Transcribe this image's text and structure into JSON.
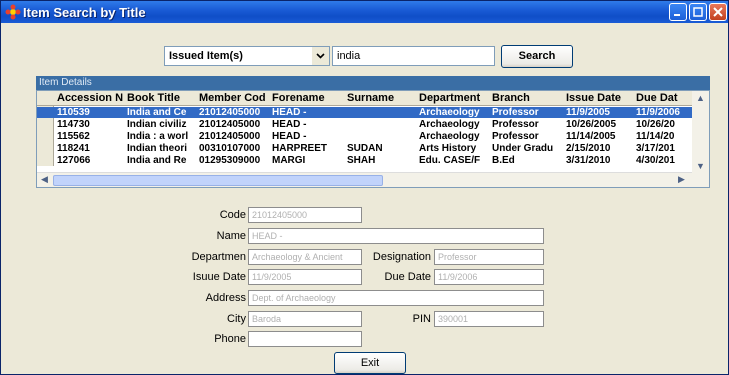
{
  "window": {
    "title": "Item Search by Title"
  },
  "search": {
    "filter_value": "Issued Item(s)",
    "query": "india",
    "button_label": "Search"
  },
  "grid": {
    "group_title": "Item Details",
    "columns": [
      "Accession N",
      "Book Title",
      "Member Cod",
      "Forename",
      "Surname",
      "Department",
      "Branch",
      "Issue Date",
      "Due Dat"
    ],
    "rows": [
      [
        "110539",
        "India and Ce",
        "21012405000",
        "HEAD -",
        "",
        "Archaeology",
        "Professor",
        "11/9/2005",
        "11/9/2006"
      ],
      [
        "114730",
        "Indian civiliz",
        "21012405000",
        "HEAD -",
        "",
        "Archaeology",
        "Professor",
        "10/26/2005",
        "10/26/20"
      ],
      [
        "115562",
        "India : a worl",
        "21012405000",
        "HEAD -",
        "",
        "Archaeology",
        "Professor",
        "11/14/2005",
        "11/14/20"
      ],
      [
        "118241",
        "Indian theori",
        "00310107000",
        "HARPREET",
        "SUDAN",
        "Arts History",
        "Under Gradu",
        "2/15/2010",
        "3/17/201"
      ],
      [
        "127066",
        "India and Re",
        "01295309000",
        "MARGI",
        "SHAH",
        "Edu. CASE/F",
        "B.Ed",
        "3/31/2010",
        "4/30/201"
      ]
    ]
  },
  "details": {
    "code_label": "Code",
    "code_value": "21012405000",
    "name_label": "Name",
    "name_value": "HEAD -",
    "department_label": "Departmen",
    "department_value": "Archaeology & Ancient",
    "designation_label": "Designation",
    "designation_value": "Professor",
    "issue_date_label": "Isuue Date",
    "issue_date_value": "11/9/2005",
    "due_date_label": "Due Date",
    "due_date_value": "11/9/2006",
    "address_label": "Address",
    "address_value": "Dept. of Archaeology",
    "city_label": "City",
    "city_value": "Baroda",
    "pin_label": "PIN",
    "pin_value": "390001",
    "phone_label": "Phone",
    "phone_value": ""
  },
  "exit": {
    "label": "Exit"
  }
}
